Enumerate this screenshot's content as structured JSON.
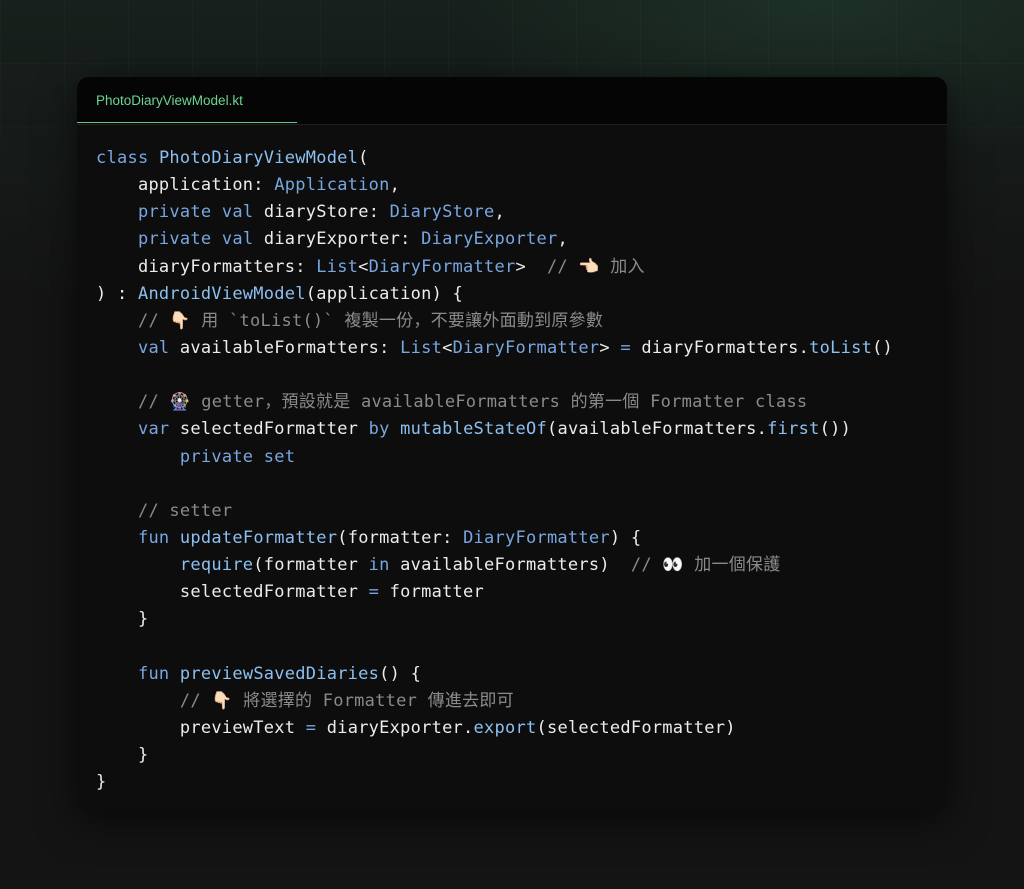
{
  "file_tab": {
    "label": "PhotoDiaryViewModel.kt"
  },
  "code_lines": [
    [
      [
        "kw",
        "class"
      ],
      [
        "pn",
        " "
      ],
      [
        "fn",
        "PhotoDiaryViewModel"
      ],
      [
        "pn",
        "("
      ]
    ],
    [
      [
        "pn",
        "    "
      ],
      [
        "id",
        "application"
      ],
      [
        "pn",
        ": "
      ],
      [
        "ty",
        "Application"
      ],
      [
        "pn",
        ","
      ]
    ],
    [
      [
        "pn",
        "    "
      ],
      [
        "kw",
        "private"
      ],
      [
        "pn",
        " "
      ],
      [
        "kw",
        "val"
      ],
      [
        "pn",
        " "
      ],
      [
        "id",
        "diaryStore"
      ],
      [
        "pn",
        ": "
      ],
      [
        "ty",
        "DiaryStore"
      ],
      [
        "pn",
        ","
      ]
    ],
    [
      [
        "pn",
        "    "
      ],
      [
        "kw",
        "private"
      ],
      [
        "pn",
        " "
      ],
      [
        "kw",
        "val"
      ],
      [
        "pn",
        " "
      ],
      [
        "id",
        "diaryExporter"
      ],
      [
        "pn",
        ": "
      ],
      [
        "ty",
        "DiaryExporter"
      ],
      [
        "pn",
        ","
      ]
    ],
    [
      [
        "pn",
        "    "
      ],
      [
        "id",
        "diaryFormatters"
      ],
      [
        "pn",
        ": "
      ],
      [
        "ty",
        "List"
      ],
      [
        "pn",
        "<"
      ],
      [
        "ty",
        "DiaryFormatter"
      ],
      [
        "pn",
        ">  "
      ],
      [
        "cm",
        "// 👈🏻 加入"
      ]
    ],
    [
      [
        "pn",
        ") : "
      ],
      [
        "fn",
        "AndroidViewModel"
      ],
      [
        "pn",
        "("
      ],
      [
        "id",
        "application"
      ],
      [
        "pn",
        ") {"
      ]
    ],
    [
      [
        "pn",
        "    "
      ],
      [
        "cm",
        "// 👇🏻 用 `toList()` 複製一份，不要讓外面動到原參數"
      ]
    ],
    [
      [
        "pn",
        "    "
      ],
      [
        "kw",
        "val"
      ],
      [
        "pn",
        " "
      ],
      [
        "id",
        "availableFormatters"
      ],
      [
        "pn",
        ": "
      ],
      [
        "ty",
        "List"
      ],
      [
        "pn",
        "<"
      ],
      [
        "ty",
        "DiaryFormatter"
      ],
      [
        "pn",
        "> "
      ],
      [
        "op",
        "="
      ],
      [
        "pn",
        " "
      ],
      [
        "id",
        "diaryFormatters"
      ],
      [
        "pn",
        "."
      ],
      [
        "fn",
        "toList"
      ],
      [
        "pn",
        "()"
      ]
    ],
    [],
    [
      [
        "pn",
        "    "
      ],
      [
        "cm",
        "// 🎡 getter，預設就是 availableFormatters 的第一個 Formatter class"
      ]
    ],
    [
      [
        "pn",
        "    "
      ],
      [
        "kw",
        "var"
      ],
      [
        "pn",
        " "
      ],
      [
        "id",
        "selectedFormatter"
      ],
      [
        "pn",
        " "
      ],
      [
        "kw",
        "by"
      ],
      [
        "pn",
        " "
      ],
      [
        "fn",
        "mutableStateOf"
      ],
      [
        "pn",
        "("
      ],
      [
        "id",
        "availableFormatters"
      ],
      [
        "pn",
        "."
      ],
      [
        "fn",
        "first"
      ],
      [
        "pn",
        "())"
      ]
    ],
    [
      [
        "pn",
        "        "
      ],
      [
        "kw",
        "private"
      ],
      [
        "pn",
        " "
      ],
      [
        "kw",
        "set"
      ]
    ],
    [],
    [
      [
        "pn",
        "    "
      ],
      [
        "cm",
        "// setter"
      ]
    ],
    [
      [
        "pn",
        "    "
      ],
      [
        "kw",
        "fun"
      ],
      [
        "pn",
        " "
      ],
      [
        "fn",
        "updateFormatter"
      ],
      [
        "pn",
        "("
      ],
      [
        "id",
        "formatter"
      ],
      [
        "pn",
        ": "
      ],
      [
        "ty",
        "DiaryFormatter"
      ],
      [
        "pn",
        ") {"
      ]
    ],
    [
      [
        "pn",
        "        "
      ],
      [
        "fn",
        "require"
      ],
      [
        "pn",
        "("
      ],
      [
        "id",
        "formatter"
      ],
      [
        "pn",
        " "
      ],
      [
        "kw",
        "in"
      ],
      [
        "pn",
        " "
      ],
      [
        "id",
        "availableFormatters"
      ],
      [
        "pn",
        ")  "
      ],
      [
        "cm",
        "// 👀 加一個保護"
      ]
    ],
    [
      [
        "pn",
        "        "
      ],
      [
        "id",
        "selectedFormatter"
      ],
      [
        "pn",
        " "
      ],
      [
        "op",
        "="
      ],
      [
        "pn",
        " "
      ],
      [
        "id",
        "formatter"
      ]
    ],
    [
      [
        "pn",
        "    }"
      ]
    ],
    [],
    [
      [
        "pn",
        "    "
      ],
      [
        "kw",
        "fun"
      ],
      [
        "pn",
        " "
      ],
      [
        "fn",
        "previewSavedDiaries"
      ],
      [
        "pn",
        "() {"
      ]
    ],
    [
      [
        "pn",
        "        "
      ],
      [
        "cm",
        "// 👇🏻 將選擇的 Formatter 傳進去即可"
      ]
    ],
    [
      [
        "pn",
        "        "
      ],
      [
        "id",
        "previewText"
      ],
      [
        "pn",
        " "
      ],
      [
        "op",
        "="
      ],
      [
        "pn",
        " "
      ],
      [
        "id",
        "diaryExporter"
      ],
      [
        "pn",
        "."
      ],
      [
        "fn",
        "export"
      ],
      [
        "pn",
        "("
      ],
      [
        "id",
        "selectedFormatter"
      ],
      [
        "pn",
        ")"
      ]
    ],
    [
      [
        "pn",
        "    }"
      ]
    ],
    [
      [
        "pn",
        "}"
      ]
    ]
  ],
  "colors": {
    "tab_accent": "#6cd592",
    "keyword": "#78a6e0",
    "function": "#8cc0f0",
    "comment": "#8a8a8a",
    "text": "#ececec"
  }
}
